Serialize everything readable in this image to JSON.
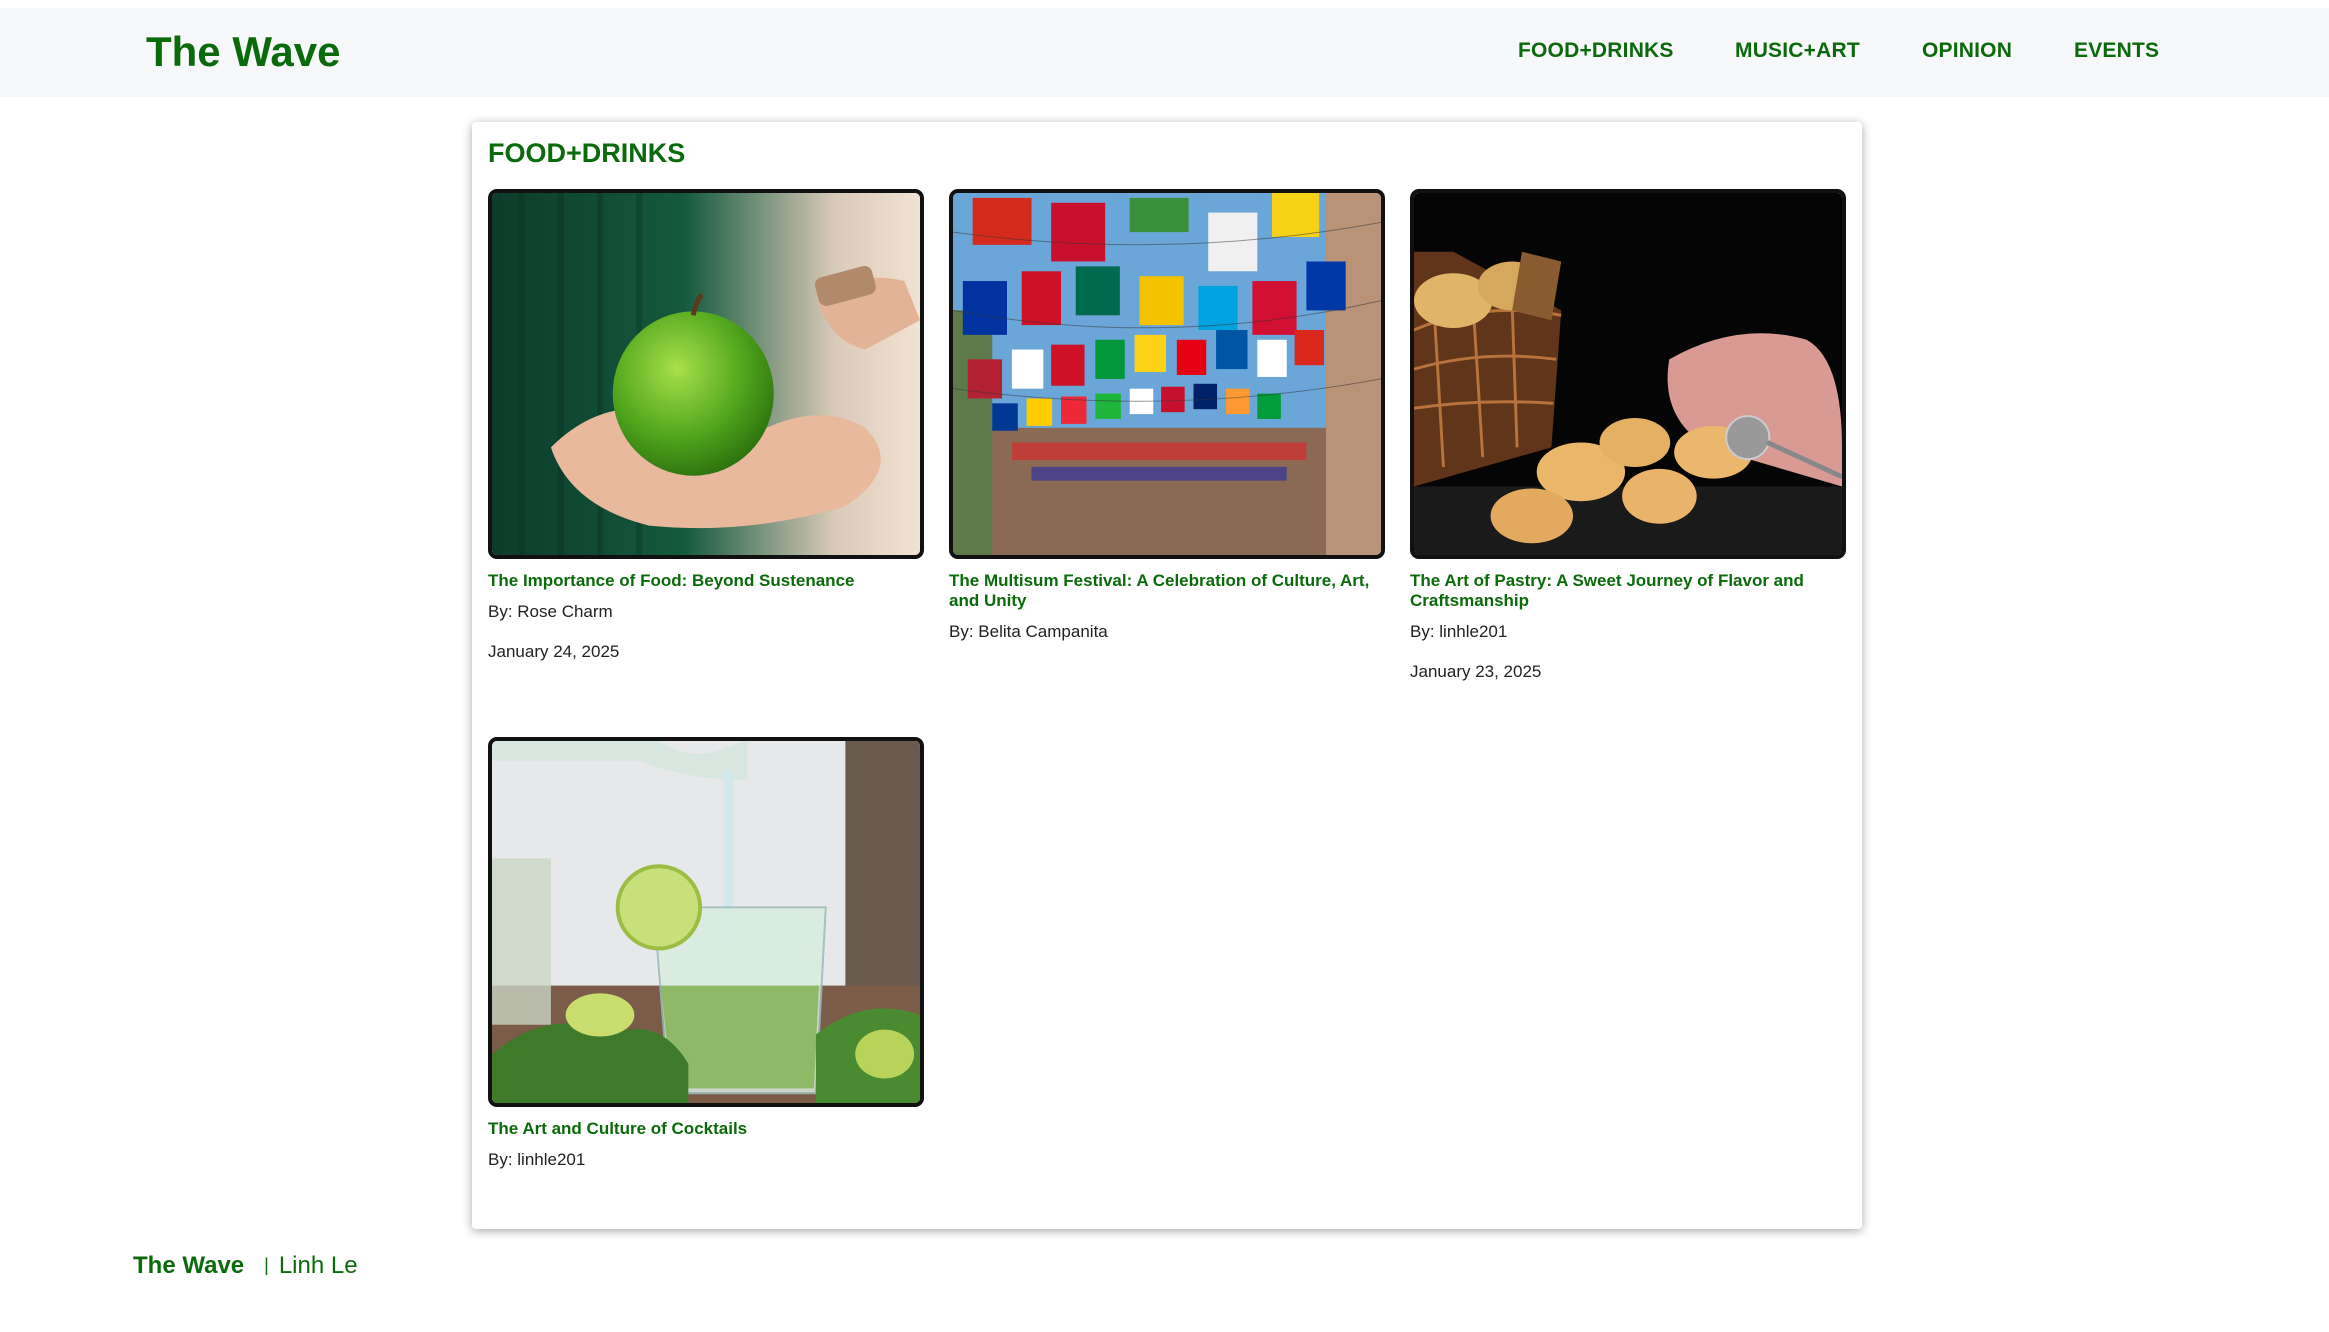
{
  "header": {
    "brand": "The Wave",
    "nav": [
      "FOOD+DRINKS",
      "MUSIC+ART",
      "OPINION",
      "EVENTS"
    ]
  },
  "main": {
    "section_title": "FOOD+DRINKS",
    "articles": [
      {
        "image": "green-apple-in-hands-image",
        "title": "The Importance of Food: Beyond Sustenance",
        "author": "By: Rose Charm",
        "date": "January 24, 2025"
      },
      {
        "image": "street-flags-image",
        "title": "The Multisum Festival: A Celebration of Culture, Art, and Unity",
        "author": "By: Belita Campanita",
        "date": ""
      },
      {
        "image": "pastry-basket-image",
        "title": "The Art of Pastry: A Sweet Journey of Flavor and Craftsmanship",
        "author": "By: linhle201",
        "date": "January 23, 2025"
      },
      {
        "image": "mojito-cocktail-image",
        "title": "The Art and Culture of Cocktails",
        "author": "By: linhle201",
        "date": ""
      }
    ]
  },
  "footer": {
    "brand": "The Wave",
    "separator": "|",
    "author": "Linh Le"
  },
  "colors": {
    "brand_green": "#0b6a0b",
    "header_bg": "#f7f8fa"
  }
}
